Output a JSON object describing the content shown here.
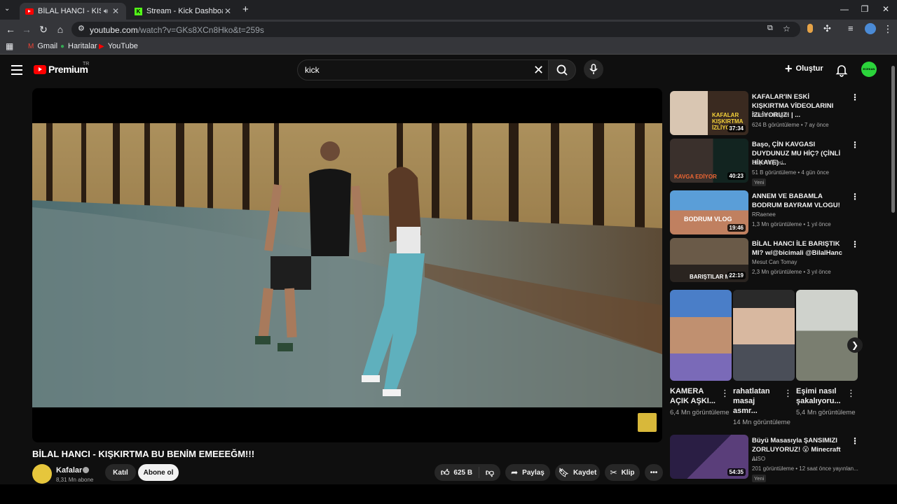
{
  "browser": {
    "tabs": [
      {
        "title": "BİLAL HANCI - KIŞKIRTMA B",
        "active": true
      },
      {
        "title": "Stream - Kick Dashboard",
        "active": false
      }
    ],
    "url_host": "youtube.com",
    "url_path": "/watch?v=GKs8XCn8Hko&t=259s",
    "bookmarks": [
      "Gmail",
      "Haritalar",
      "YouTube"
    ]
  },
  "header": {
    "logo_text": "Premium",
    "region": "TR",
    "search_value": "kick",
    "create_label": "Oluştur",
    "avatar_text": "ECEKAN"
  },
  "video": {
    "title": "BİLAL HANCI - KIŞKIRTMA BU BENİM EMEEEĞM!!!",
    "channel": "Kafalar",
    "subscribers": "8,31 Mn abone",
    "join_label": "Katıl",
    "subscribe_label": "Abone ol",
    "likes": "625 B",
    "share_label": "Paylaş",
    "save_label": "Kaydet",
    "clip_label": "Klip"
  },
  "recommendations": [
    {
      "title": "KAFALAR'IN ESKİ KIŞKIRTMA VİDEOLARINI İZLİYORUZ! | ...",
      "channel": "Ataberk Doğan",
      "meta": "624 B görüntüleme • 7 ay önce",
      "duration": "37:34",
      "badge": ""
    },
    {
      "title": "Başo, ÇİN KAVGASI DUYDUNUZ MU HİÇ? (ÇİNLİ HİKAYE) ...",
      "channel": "Başo Klipleri",
      "meta": "51 B görüntüleme • 4 gün önce",
      "duration": "40:23",
      "badge": "Yeni"
    },
    {
      "title": "ANNEM VE BABAMLA BODRUM BAYRAM VLOGU!",
      "channel": "RRaenee",
      "meta": "1,3 Mn görüntüleme • 1 yıl önce",
      "duration": "19:46",
      "badge": ""
    },
    {
      "title": "BİLAL HANCI İLE BARIŞTIK MI? w/@bicimali @BilalHanc",
      "channel": "Mesut Can Tomay",
      "meta": "2,3 Mn görüntüleme • 3 yıl önce",
      "duration": "22:19",
      "badge": ""
    }
  ],
  "shorts": [
    {
      "title": "KAMERA AÇIK AŞKI...",
      "views": "6,4 Mn görüntüleme"
    },
    {
      "title": "rahatlatan masaj asmr...",
      "views": "14 Mn görüntüleme"
    },
    {
      "title": "Eşimi nasıl şakalıyoru...",
      "views": "5,4 Mn görüntüleme"
    }
  ],
  "last_rec": {
    "title": "Büyü Masasıyla ŞANSIMIZI ZORLUYORUZ! 😮 Minecraft ...",
    "channel": "AISO",
    "meta": "201 görüntüleme • 12 saat önce yayınlan...",
    "duration": "54:35",
    "badge": "Yeni"
  },
  "thumb_captions": [
    "KAFALAR KIŞKIRTMA İZLİYO",
    "KAVGA EDİYOR",
    "BODRUM VLOG",
    "BARIŞTILAR MI"
  ]
}
